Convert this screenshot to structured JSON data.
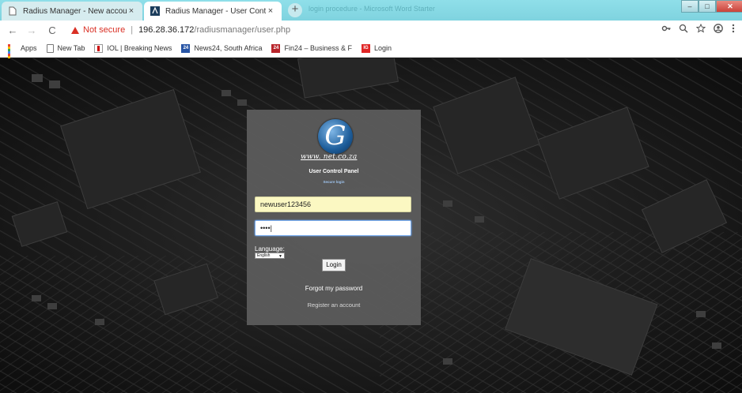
{
  "browser": {
    "tabs": [
      {
        "title": "Radius Manager - New account /",
        "active": false
      },
      {
        "title": "Radius Manager - User Control P",
        "active": true
      }
    ],
    "new_tab_symbol": "+",
    "close_symbol": "×",
    "window_ghost_title": "login procedure - Microsoft Word Starter",
    "nav": {
      "back": "←",
      "forward": "→",
      "reload": "C"
    },
    "security_label": "Not secure",
    "url_host": "196.28.36.172",
    "url_path": "/radiusmanager/user.php",
    "icons": [
      "key-icon",
      "zoom-icon",
      "star-icon",
      "account-icon",
      "menu-icon"
    ]
  },
  "bookmarks": [
    {
      "label": "Apps",
      "icon": "apps-icon"
    },
    {
      "label": "New Tab",
      "icon": "page-icon"
    },
    {
      "label": "IOL | Breaking News",
      "icon": "iol-icon"
    },
    {
      "label": "News24, South Africa",
      "icon": "news24-icon"
    },
    {
      "label": "Fin24 – Business & F",
      "icon": "fin24-icon"
    },
    {
      "label": "Login",
      "icon": "ig-icon"
    }
  ],
  "panel": {
    "logo_text": "www. net.co.za",
    "title": "User Control Panel",
    "subtitle": "Secure login",
    "username_value": "newuser123456",
    "password_value": "••••|",
    "language_label": "Language:",
    "language_selected": "English",
    "login_button": "Login",
    "forgot_link": "Forgot my password",
    "register_link": "Register an account"
  },
  "colors": {
    "titlebar": "#8fdfe9",
    "panel_bg": "#5c5c5c",
    "username_bg": "#fbf8c2",
    "security_red": "#d93025"
  }
}
